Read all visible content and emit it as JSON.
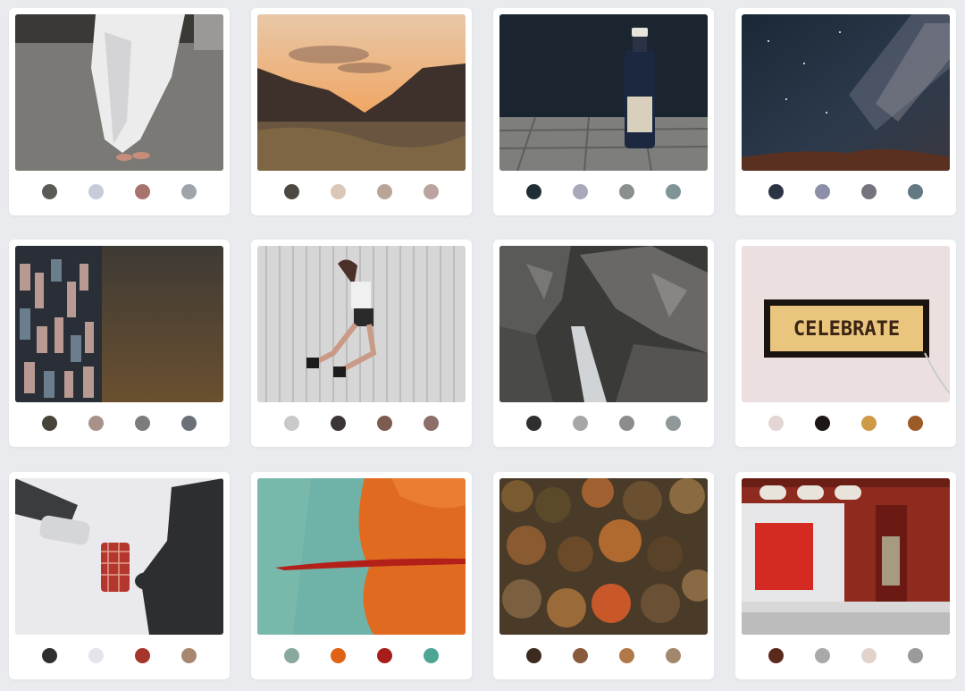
{
  "gallery": {
    "cards": [
      {
        "image": "photo-white-robe-feet",
        "palette": [
          "#5a5b57",
          "#c7cad7",
          "#a8736c",
          "#9ea5aa"
        ]
      },
      {
        "image": "photo-mountain-sunset",
        "palette": [
          "#4e4842",
          "#dbc7b8",
          "#b9a596",
          "#b9a4a0"
        ]
      },
      {
        "image": "photo-gin-bottle",
        "palette": [
          "#1f2d35",
          "#a7a9bb",
          "#8b8f8f",
          "#7f9496"
        ]
      },
      {
        "image": "photo-milky-way",
        "palette": [
          "#2b3445",
          "#8d8ea8",
          "#76737e",
          "#637981"
        ]
      },
      {
        "image": "photo-building-dusk",
        "palette": [
          "#47443a",
          "#a89189",
          "#7b7c7e",
          "#6b6f77"
        ]
      },
      {
        "image": "photo-jumping-woman",
        "palette": [
          "#c9c9c9",
          "#3c3536",
          "#7c5c4e",
          "#8e6e69"
        ]
      },
      {
        "image": "photo-waterfall-canyon",
        "palette": [
          "#2f2f2f",
          "#a7a7a7",
          "#8a8c8d",
          "#8f9898"
        ]
      },
      {
        "image": "photo-celebrate-sign",
        "palette": [
          "#e3d5d4",
          "#1c1614",
          "#cf9a46",
          "#9c5a25"
        ],
        "sign_text": "CELEBRATE"
      },
      {
        "image": "photo-pouring-drink",
        "palette": [
          "#2e3130",
          "#e4e4ec",
          "#a6352c",
          "#a78770"
        ]
      },
      {
        "image": "photo-teal-orange-paint",
        "palette": [
          "#8aa99d",
          "#e06214",
          "#a81d1b",
          "#4ea593"
        ]
      },
      {
        "image": "photo-autumn-forest",
        "palette": [
          "#3c2a1e",
          "#8a5a3c",
          "#b17848",
          "#a3876d"
        ]
      },
      {
        "image": "photo-red-storefront",
        "palette": [
          "#5a291b",
          "#a9a9a9",
          "#e2d2cc",
          "#9a9a9a"
        ]
      }
    ]
  }
}
